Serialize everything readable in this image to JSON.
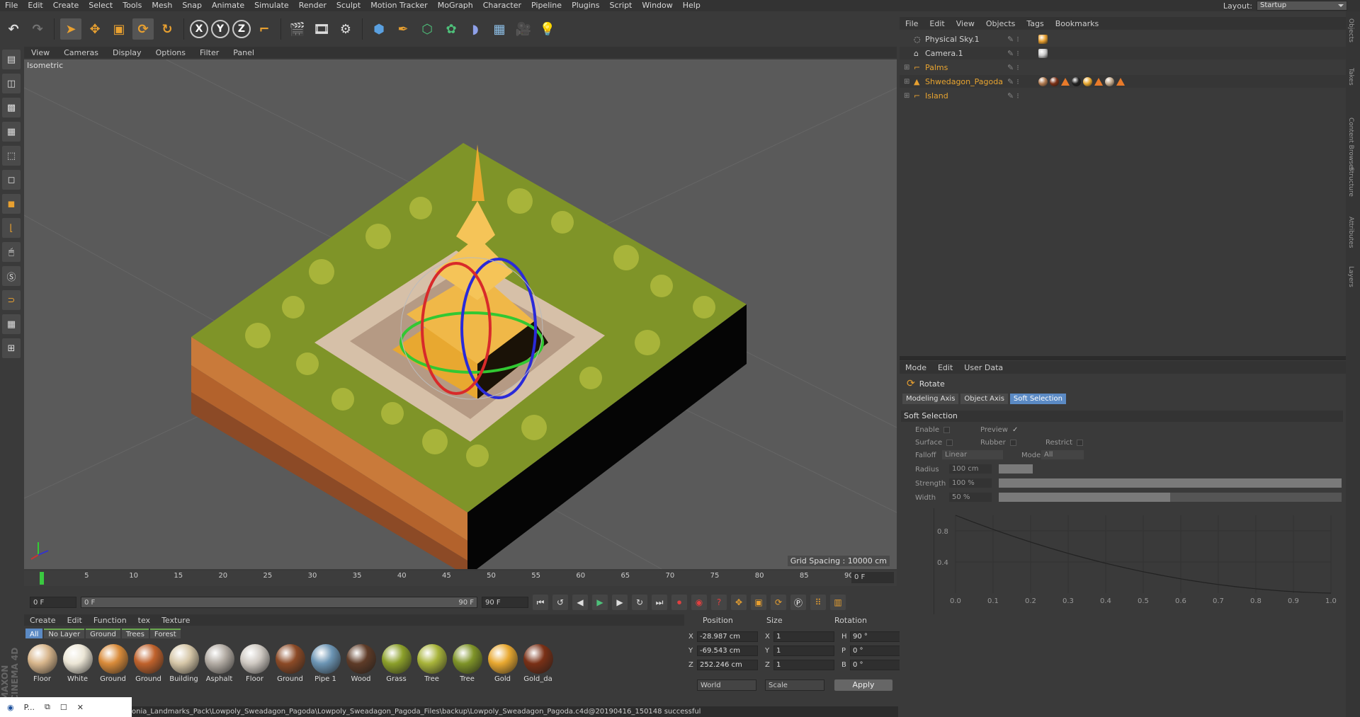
{
  "menubar": [
    "File",
    "Edit",
    "Create",
    "Select",
    "Tools",
    "Mesh",
    "Snap",
    "Animate",
    "Simulate",
    "Render",
    "Sculpt",
    "Motion Tracker",
    "MoGraph",
    "Character",
    "Pipeline",
    "Plugins",
    "Script",
    "Window",
    "Help"
  ],
  "layout": {
    "label": "Layout:",
    "value": "Startup"
  },
  "toolbar_axes": [
    "X",
    "Y",
    "Z"
  ],
  "viewport": {
    "menu": [
      "View",
      "Cameras",
      "Display",
      "Options",
      "Filter",
      "Panel"
    ],
    "label": "Isometric",
    "grid_spacing": "Grid Spacing : 10000 cm"
  },
  "timeline": {
    "ticks": [
      "0",
      "5",
      "10",
      "15",
      "20",
      "25",
      "30",
      "35",
      "40",
      "45",
      "50",
      "55",
      "60",
      "65",
      "70",
      "75",
      "80",
      "85",
      "90"
    ],
    "current_frame": "0 F"
  },
  "transport": {
    "start": "0 F",
    "range_start": "0 F",
    "range_end": "90 F",
    "end": "90 F"
  },
  "materials": {
    "menu": [
      "Create",
      "Edit",
      "Function",
      "tex",
      "Texture"
    ],
    "tabs": [
      "All",
      "No Layer",
      "Ground",
      "Trees",
      "Forest"
    ],
    "items": [
      {
        "label": "Floor",
        "color": "#d8b68c"
      },
      {
        "label": "White",
        "color": "#ece6d6"
      },
      {
        "label": "Ground",
        "color": "#d98b3a"
      },
      {
        "label": "Ground",
        "color": "#c0622c"
      },
      {
        "label": "Building",
        "color": "#d6c7a8"
      },
      {
        "label": "Asphalt",
        "color": "#b3aca4"
      },
      {
        "label": "Floor",
        "color": "#cfc9c2"
      },
      {
        "label": "Ground",
        "color": "#8c4a26"
      },
      {
        "label": "Pipe 1",
        "color": "#6c95b4"
      },
      {
        "label": "Wood",
        "color": "#5e3b27"
      },
      {
        "label": "Grass",
        "color": "#8ca02a"
      },
      {
        "label": "Tree",
        "color": "#a8b43a"
      },
      {
        "label": "Tree",
        "color": "#7f9428"
      },
      {
        "label": "Gold",
        "color": "#e8a830"
      },
      {
        "label": "Gold_da",
        "color": "#7a3016"
      }
    ]
  },
  "coords": {
    "headers": [
      "Position",
      "Size",
      "Rotation"
    ],
    "rows": [
      {
        "axis": "X",
        "pos": "-28.987 cm",
        "saxis": "X",
        "size": "1",
        "raxis": "H",
        "rot": "90 °"
      },
      {
        "axis": "Y",
        "pos": "-69.543 cm",
        "saxis": "Y",
        "size": "1",
        "raxis": "P",
        "rot": "0 °"
      },
      {
        "axis": "Z",
        "pos": "252.246 cm",
        "saxis": "Z",
        "size": "1",
        "raxis": "B",
        "rot": "0 °"
      }
    ],
    "world": "World",
    "scale": "Scale",
    "apply": "Apply"
  },
  "objects": {
    "menu": [
      "File",
      "Edit",
      "View",
      "Objects",
      "Tags",
      "Bookmarks"
    ],
    "rows": [
      {
        "name": "Physical Sky.1",
        "color": "#d0d0d0"
      },
      {
        "name": "Camera.1",
        "color": "#d0d0d0"
      },
      {
        "name": "Palms",
        "color": "#e8a430"
      },
      {
        "name": "Shwedagon_Pagoda",
        "color": "#e8a430"
      },
      {
        "name": "Island",
        "color": "#e8a430"
      }
    ]
  },
  "attributes": {
    "menu": [
      "Mode",
      "Edit",
      "User Data"
    ],
    "title": "Rotate",
    "tabs": [
      "Modeling Axis",
      "Object Axis",
      "Soft Selection"
    ],
    "section": "Soft Selection",
    "labels": {
      "enable": "Enable",
      "preview": "Preview",
      "surface": "Surface",
      "rubber": "Rubber",
      "restrict": "Restrict",
      "falloff": "Falloff",
      "falloff_val": "Linear",
      "mode": "Mode",
      "mode_val": "All",
      "radius": "Radius",
      "radius_val": "100 cm",
      "strength": "Strength",
      "strength_val": "100 %",
      "width": "Width",
      "width_val": "50 %"
    },
    "strength": 1.0,
    "width": 0.5,
    "graph": {
      "yticks": [
        "0.8",
        "0.4"
      ],
      "xticks": [
        "0.0",
        "0.1",
        "0.2",
        "0.3",
        "0.4",
        "0.5",
        "0.6",
        "0.7",
        "0.8",
        "0.9",
        "1.0"
      ]
    }
  },
  "sidebar": [
    "Objects",
    "Takes",
    "Content Browser",
    "Structure",
    "Attributes",
    "Layers"
  ],
  "status": "onia_Landmarks_Pack\\Lowpoly_Sweadagon_Pagoda\\Lowpoly_Sweadagon_Pagoda_Files\\backup\\Lowpoly_Sweadagon_Pagoda.c4d@20190416_150148 successful",
  "taskbar": "P...",
  "maxon": "MAXON CINEMA 4D"
}
